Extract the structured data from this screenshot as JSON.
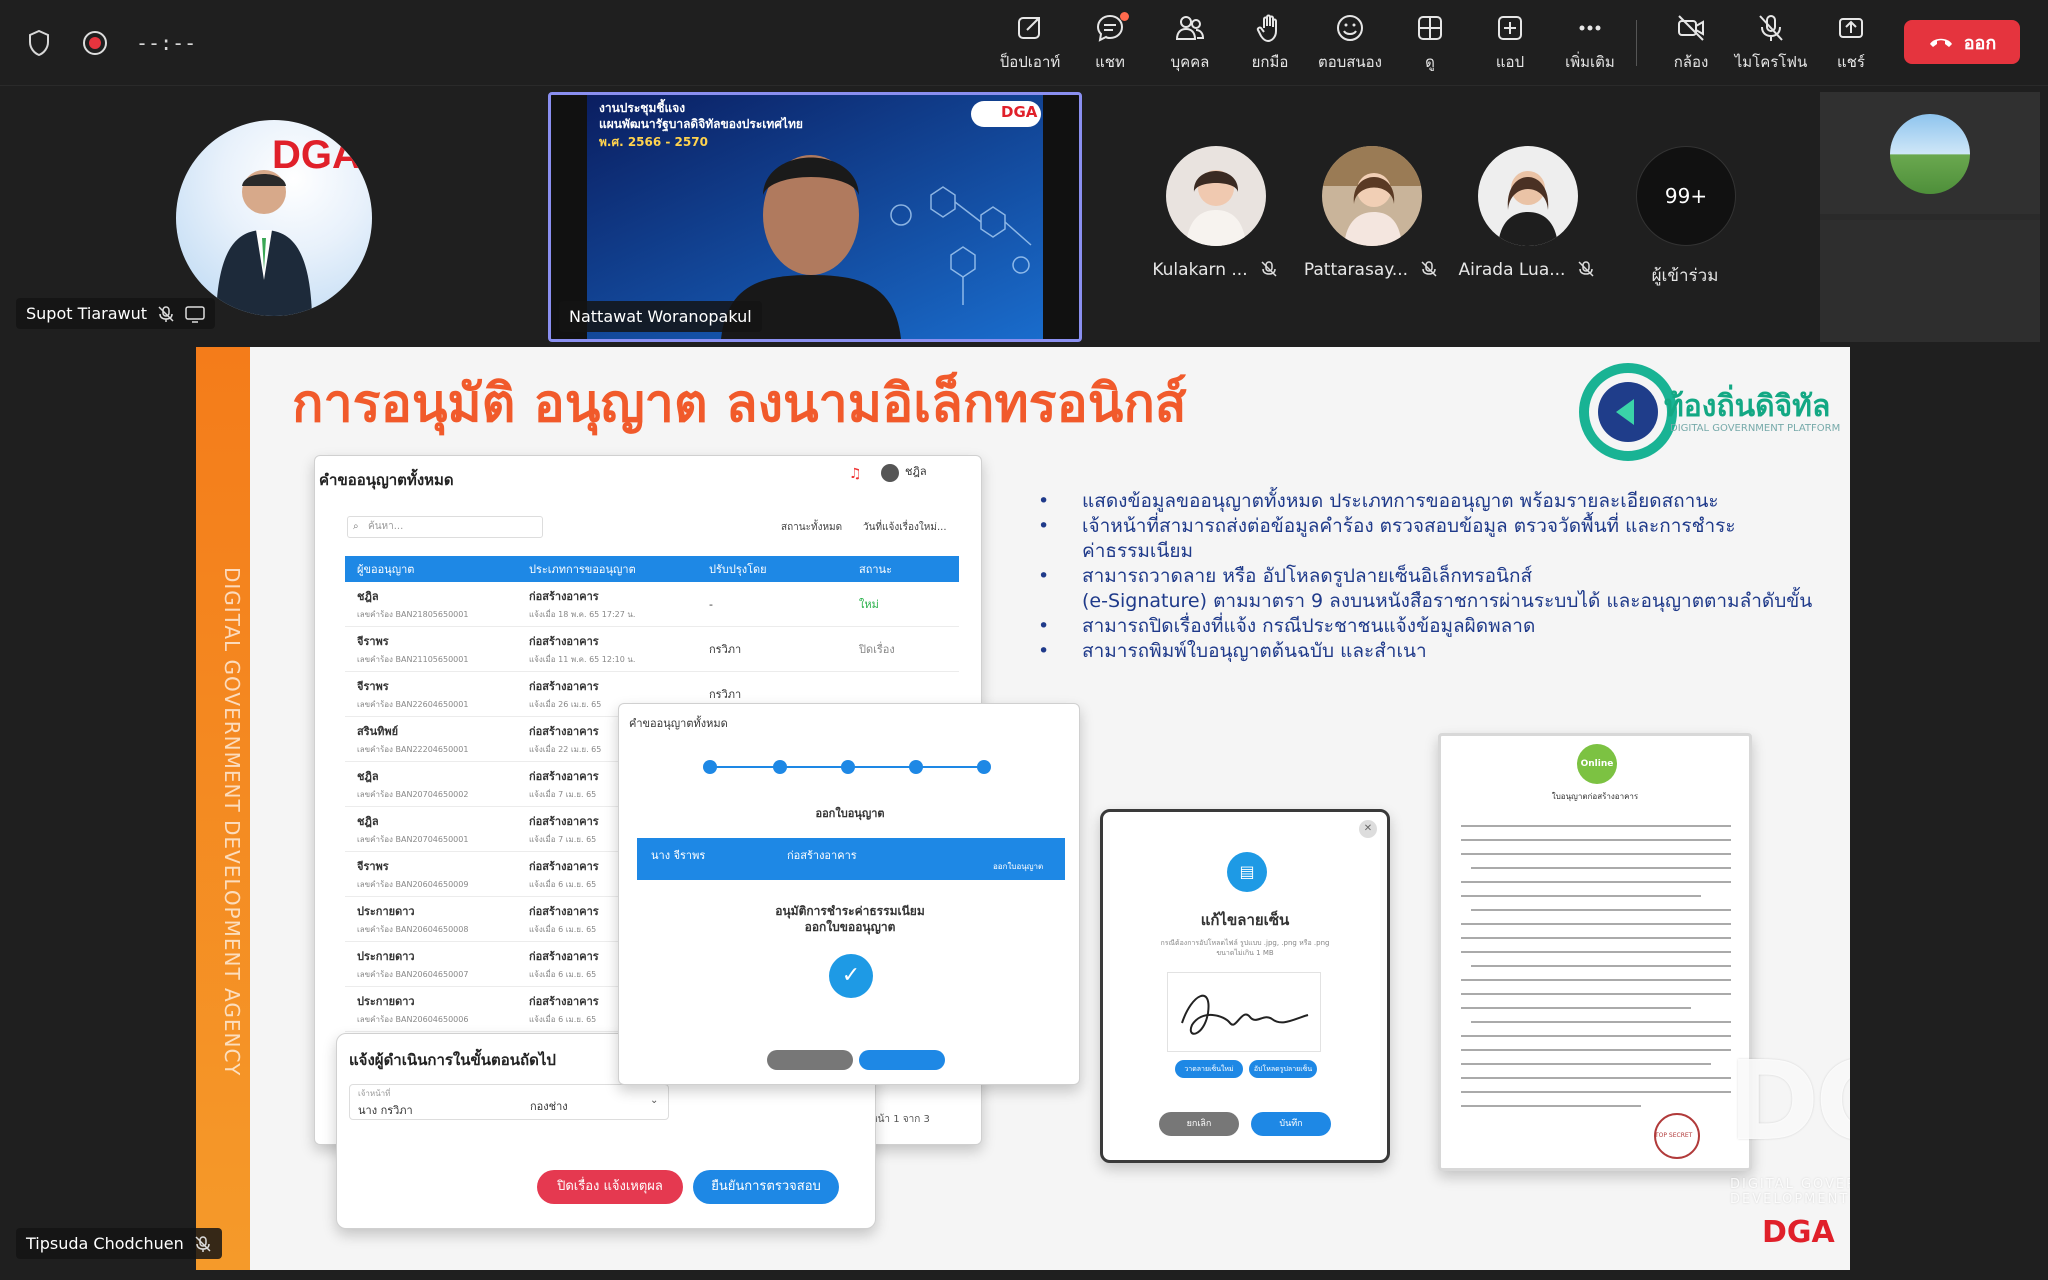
{
  "topbar": {
    "timer": "--:--",
    "actions": [
      {
        "label": "ป็อปเอาท์",
        "icon": "popout-icon"
      },
      {
        "label": "แชท",
        "icon": "chat-icon"
      },
      {
        "label": "บุคคล",
        "icon": "people-icon"
      },
      {
        "label": "ยกมือ",
        "icon": "raise-hand-icon"
      },
      {
        "label": "ตอบสนอง",
        "icon": "react-icon"
      },
      {
        "label": "ดู",
        "icon": "view-icon"
      },
      {
        "label": "แอป",
        "icon": "apps-icon"
      },
      {
        "label": "เพิ่มเติม",
        "icon": "more-icon"
      }
    ],
    "media": [
      {
        "label": "กล้อง",
        "icon": "camera-off-icon"
      },
      {
        "label": "ไมโครโฟน",
        "icon": "mic-off-icon"
      },
      {
        "label": "แชร์",
        "icon": "share-icon"
      }
    ],
    "leave_label": "ออก",
    "leave_color": "#e5343e"
  },
  "participants": {
    "presenter_left": "Supot Tiarawut",
    "presenter_left_logo": "DGA",
    "active_speaker": "Nattawat Woranopakul",
    "speaker_bg_title": "งานประชุมชี้แจง",
    "speaker_bg_subtitle": "แผนพัฒนารัฐบาลดิจิทัลของประเทศไทย",
    "speaker_bg_years": "พ.ศ. 2566 - 2570",
    "speaker_bg_logo": "DGA",
    "others": [
      {
        "name": "Kulakarn ...",
        "muted": true
      },
      {
        "name": "Pattarasay...",
        "muted": true
      },
      {
        "name": "Airada Lua...",
        "muted": true
      }
    ],
    "more_count": "99+",
    "more_label": "ผู้เข้าร่วม",
    "self_view_name": "Tipsuda Chodchuen"
  },
  "slide": {
    "title": "การอนุมัติ อนุญาต ลงนามอิเล็กทรอนิกส์",
    "band_text": "DIGITAL GOVERNMENT DEVELOPMENT AGENCY",
    "logo_text": "ท้องถิ่นดิจิทัล",
    "logo_sub": "DIGITAL GOVERNMENT PLATFORM",
    "bullets": [
      "แสดงข้อมูลขออนุญาตทั้งหมด ประเภทการขออนุญาต พร้อมรายละเอียดสถานะ",
      "เจ้าหน้าที่สามารถส่งต่อข้อมูลคำร้อง ตรวจสอบข้อมูล ตรวจวัดพื้นที่ และการชำระ",
      "ค่าธรรมเนียม",
      "สามารถวาดลาย หรือ อัปโหลดรูปลายเซ็นอิเล็กทรอนิกส์",
      "(e-Signature) ตามมาตรา 9 ลงบนหนังสือราชการผ่านระบบได้ และอนุญาตตามลำดับขั้น",
      "สามารถปิดเรื่องที่แจ้ง กรณีประชาชนแจ้งข้อมูลผิดพลาด",
      "สามารถพิมพ์ใบอนุญาตต้นฉบับ และสำเนา"
    ],
    "watermark": "DGA",
    "watermark_sub": "DIGITAL GOVERNMENT DEVELOPMENT AGENCY",
    "list_mock": {
      "title": "คำขออนุญาตทั้งหมด",
      "user": "ชฎิล",
      "search_placeholder": "ค้นหา...",
      "filter1": "สถานะทั้งหมด",
      "filter2": "วันที่แจ้งเรื่องใหม่...",
      "headers": [
        "ผู้ขออนุญาต",
        "ประเภทการขออนุญาต",
        "ปรับปรุงโดย",
        "สถานะ"
      ],
      "rows": [
        {
          "name": "ชฎิล",
          "ref": "เลขคำร้อง BAN21805650001",
          "type": "ก่อสร้างอาคาร",
          "date": "แจ้งเมื่อ 18 พ.ค. 65 17:27 น.",
          "by": "-",
          "status": "ใหม่"
        },
        {
          "name": "จีราพร",
          "ref": "เลขคำร้อง BAN21105650001",
          "type": "ก่อสร้างอาคาร",
          "date": "แจ้งเมื่อ 11 พ.ค. 65 12:10 น.",
          "by": "กรวิภา",
          "status": "ปิดเรื่อง"
        },
        {
          "name": "จีราพร",
          "ref": "เลขคำร้อง BAN22604650001",
          "type": "ก่อสร้างอาคาร",
          "date": "แจ้งเมื่อ 26 เม.ย. 65",
          "by": "กรวิภา",
          "status": ""
        },
        {
          "name": "สรินทิพย์",
          "ref": "เลขคำร้อง BAN22204650001",
          "type": "ก่อสร้างอาคาร",
          "date": "แจ้งเมื่อ 22 เม.ย. 65",
          "by": "",
          "status": ""
        },
        {
          "name": "ชฎิล",
          "ref": "เลขคำร้อง BAN20704650002",
          "type": "ก่อสร้างอาคาร",
          "date": "แจ้งเมื่อ 7 เม.ย. 65",
          "by": "",
          "status": ""
        },
        {
          "name": "ชฎิล",
          "ref": "เลขคำร้อง BAN20704650001",
          "type": "ก่อสร้างอาคาร",
          "date": "แจ้งเมื่อ 7 เม.ย. 65",
          "by": "",
          "status": ""
        },
        {
          "name": "จีราพร",
          "ref": "เลขคำร้อง BAN20604650009",
          "type": "ก่อสร้างอาคาร",
          "date": "แจ้งเมื่อ 6 เม.ย. 65",
          "by": "",
          "status": ""
        },
        {
          "name": "ประกายดาว",
          "ref": "เลขคำร้อง BAN20604650008",
          "type": "ก่อสร้างอาคาร",
          "date": "แจ้งเมื่อ 6 เม.ย. 65",
          "by": "",
          "status": ""
        },
        {
          "name": "ประกายดาว",
          "ref": "เลขคำร้อง BAN20604650007",
          "type": "ก่อสร้างอาคาร",
          "date": "แจ้งเมื่อ 6 เม.ย. 65",
          "by": "",
          "status": ""
        },
        {
          "name": "ประกายดาว",
          "ref": "เลขคำร้อง BAN20604650006",
          "type": "ก่อสร้างอาคาร",
          "date": "แจ้งเมื่อ 6 เม.ย. 65",
          "by": "",
          "status": ""
        }
      ],
      "pagination": "หน้า 1 จาก 3"
    },
    "forward_mock": {
      "title": "แจ้งผู้ดำเนินการในขั้นตอนถัดไป",
      "field_label": "เจ้าหน้าที่",
      "field_value": "นาง กรวิภา",
      "field_dept": "กองช่าง",
      "btn_close": "ปิดเรื่อง แจ้งเหตุผล",
      "btn_confirm": "ยืนยันการตรวจสอบ"
    },
    "approve_mock": {
      "back": "คำขออนุญาตทั้งหมด",
      "step_title": "ออกใบอนุญาต",
      "applicant": "นาง จีราพร",
      "type": "ก่อสร้างอาคาร",
      "status": "ออกใบอนุญาต",
      "message1": "อนุมัติการชำระค่าธรรมเนียม",
      "message2": "ออกใบขออนุญาต"
    },
    "sign_mock": {
      "title": "แก้ไขลายเซ็น",
      "hint": "กรณีต้องการอัปโหลดไฟล์ รูปแบบ .jpg, .png หรือ .png ขนาดไม่เกิน 1 MB",
      "btn_draw": "วาดลายเซ็นใหม่",
      "btn_upload": "อัปโหลดรูปลายเซ็น",
      "btn_cancel": "ยกเลิก",
      "btn_save": "บันทึก"
    },
    "doc_mock": {
      "badge": "Online",
      "heading": "ใบอนุญาตก่อสร้างอาคาร",
      "stamp": "TOP SECRET"
    },
    "corner_logo": "DGA"
  }
}
